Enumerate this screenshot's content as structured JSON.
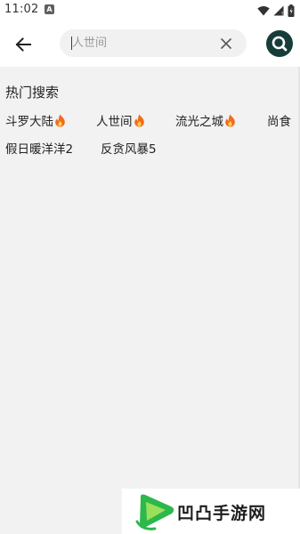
{
  "status_bar": {
    "time": "11:02",
    "notification_icon_letter": "A"
  },
  "header": {
    "search_placeholder": "人世间",
    "search_value": ""
  },
  "hot_search": {
    "title": "热门搜索",
    "tags": [
      {
        "label": "斗罗大陆",
        "hot": true
      },
      {
        "label": "人世间",
        "hot": true
      },
      {
        "label": "流光之城",
        "hot": true
      },
      {
        "label": "尚食",
        "hot": false
      },
      {
        "label": "假日暖洋洋2",
        "hot": false
      },
      {
        "label": "反贪风暴5",
        "hot": false
      }
    ]
  },
  "watermark": {
    "text": "凹凸手游网"
  },
  "colors": {
    "search_button_bg": "#173d3a",
    "content_bg": "#f2f2f2",
    "fire": "#f36b1c",
    "watermark_green": "#2db84b"
  }
}
